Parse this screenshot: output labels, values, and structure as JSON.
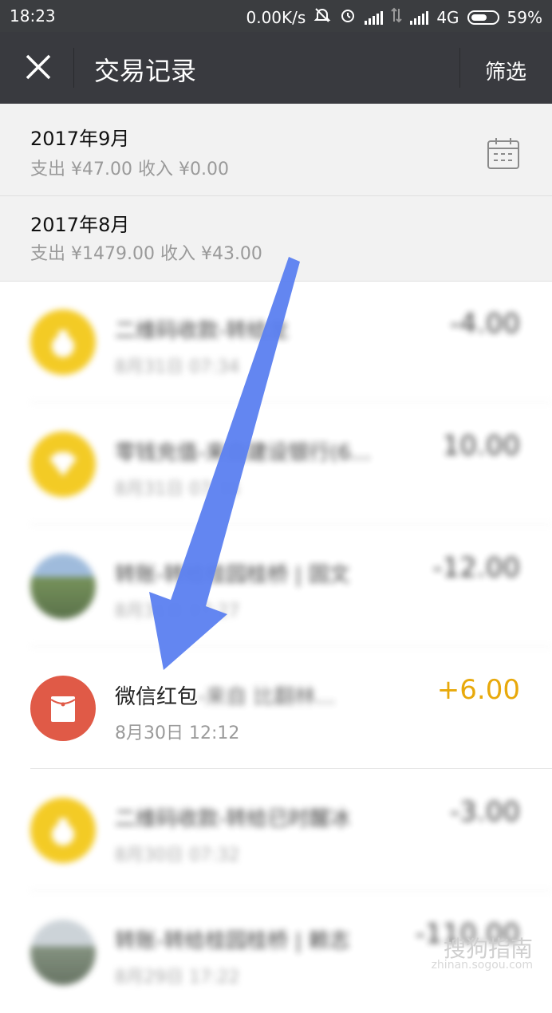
{
  "status_bar": {
    "time": "18:23",
    "speed": "0.00K/s",
    "network": "4G",
    "battery": "59%",
    "battery_fraction": 0.59,
    "icons": [
      "bell-off-icon",
      "alarm-icon",
      "signal-icon",
      "data-arrows-icon",
      "signal-icon",
      "battery-icon"
    ]
  },
  "title_bar": {
    "close_icon": "close-icon",
    "title": "交易记录",
    "filter": "筛选"
  },
  "months": [
    {
      "title": "2017年9月",
      "summary": "支出 ¥47.00 收入 ¥0.00",
      "icon": "calendar-icon"
    },
    {
      "title": "2017年8月",
      "summary": "支出 ¥1479.00 收入 ¥43.00"
    }
  ],
  "transactions": [
    {
      "name": "二维码收款-转给龙",
      "date": "8月31日 07:34",
      "amount": "-4.00",
      "icon": "money-bag-icon",
      "color": "#f2c200",
      "blurred": true
    },
    {
      "name": "零钱充值-来自建设银行(6...",
      "date": "8月31日 07:36",
      "amount": "10.00",
      "icon": "diamond-icon",
      "color": "#f2c200",
      "blurred": true
    },
    {
      "name": "转账-转给桂园桂桥 | 固文",
      "date": "8月31日 07:27",
      "amount": "-12.00",
      "icon": "landscape-avatar",
      "color": "#6f8a4d",
      "blurred": true
    },
    {
      "name": "微信红包",
      "name_rest": "-来自 比翻林...",
      "date": "8月30日 12:12",
      "amount": "+6.00",
      "icon": "red-packet-icon",
      "color": "#e05a47",
      "blurred": false
    },
    {
      "name": "二维码收款-转给已时醒冰",
      "date": "8月30日 07:32",
      "amount": "-3.00",
      "icon": "money-bag-icon",
      "color": "#f2c200",
      "blurred": true
    },
    {
      "name": "转账-转给桂园桂桥 | 赖志",
      "date": "8月29日 17:22",
      "amount": "-110.00",
      "icon": "landscape-avatar",
      "color": "#7b8a7f",
      "blurred": true
    }
  ],
  "annotation": {
    "arrow_color": "#5b7ff0",
    "icon": "arrow-down-left-icon"
  },
  "watermark": {
    "text": "搜狗指南",
    "sub": "zhinan.sogou.com"
  }
}
